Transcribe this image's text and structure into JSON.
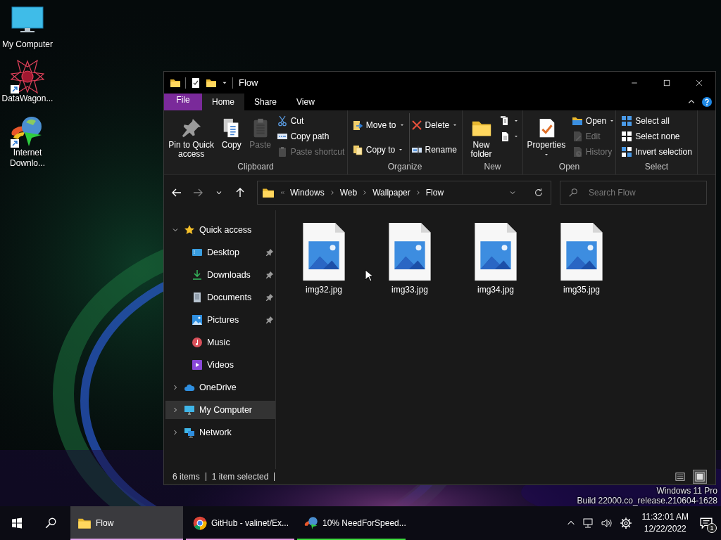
{
  "desktop": {
    "icons": [
      {
        "label": "My Computer"
      },
      {
        "label": "DataWagon..."
      },
      {
        "label": "Internet Downlo..."
      }
    ],
    "edition": [
      "Windows 11 Pro",
      "Build 22000.co_release.210604-1628"
    ]
  },
  "window": {
    "title": "Flow",
    "ribbon_tabs": [
      {
        "label": "File",
        "kind": "file",
        "selected": false
      },
      {
        "label": "Home",
        "kind": "tab",
        "selected": true
      },
      {
        "label": "Share",
        "kind": "tab",
        "selected": false
      },
      {
        "label": "View",
        "kind": "tab",
        "selected": false
      }
    ],
    "ribbon_groups": [
      {
        "label": "Clipboard",
        "columns": [
          [
            {
              "label": "Pin to Quick access",
              "kind": "large",
              "disabled": false,
              "dropdown": false
            }
          ],
          [
            {
              "label": "Copy",
              "kind": "large",
              "disabled": false,
              "dropdown": false
            }
          ],
          [
            {
              "label": "Paste",
              "kind": "large",
              "disabled": true,
              "dropdown": false
            }
          ],
          [
            {
              "label": "Cut",
              "kind": "small",
              "disabled": false,
              "dropdown": false
            },
            {
              "label": "Copy path",
              "kind": "small",
              "disabled": false,
              "dropdown": false
            },
            {
              "label": "Paste shortcut",
              "kind": "small",
              "disabled": true,
              "dropdown": false
            }
          ]
        ]
      },
      {
        "label": "Organize",
        "columns": [
          [
            {
              "label": "Move to",
              "kind": "medium",
              "disabled": false,
              "dropdown": true
            },
            {
              "label": "Copy to",
              "kind": "medium",
              "disabled": false,
              "dropdown": true
            }
          ],
          [
            {
              "label": "Delete",
              "kind": "medium",
              "disabled": false,
              "dropdown": true
            },
            {
              "label": "Rename",
              "kind": "medium",
              "disabled": false,
              "dropdown": false
            }
          ]
        ]
      },
      {
        "label": "New",
        "columns": [
          [
            {
              "label": "New folder",
              "kind": "large",
              "disabled": false,
              "dropdown": false
            }
          ],
          [
            {
              "kind": "small",
              "disabled": false,
              "dropdown": true
            },
            {
              "kind": "small",
              "disabled": false,
              "dropdown": true
            }
          ]
        ]
      },
      {
        "label": "Open",
        "columns": [
          [
            {
              "label": "Properties",
              "kind": "large",
              "disabled": false,
              "dropdown": true
            }
          ],
          [
            {
              "label": "Open",
              "kind": "small",
              "disabled": false,
              "dropdown": true
            },
            {
              "label": "Edit",
              "kind": "small",
              "disabled": true,
              "dropdown": false
            },
            {
              "label": "History",
              "kind": "small",
              "disabled": true,
              "dropdown": false
            }
          ]
        ]
      },
      {
        "label": "Select",
        "columns": [
          [
            {
              "label": "Select all",
              "kind": "small",
              "disabled": false,
              "dropdown": false
            },
            {
              "label": "Select none",
              "kind": "small",
              "disabled": false,
              "dropdown": false
            },
            {
              "label": "Invert selection",
              "kind": "small",
              "disabled": false,
              "dropdown": false
            }
          ]
        ]
      }
    ],
    "nav_buttons": [
      {
        "kind": "back",
        "disabled": false
      },
      {
        "kind": "forward",
        "disabled": true
      },
      {
        "kind": "recent",
        "disabled": false
      },
      {
        "kind": "up",
        "disabled": false
      }
    ],
    "address": {
      "crumbs": [
        "Windows",
        "Web",
        "Wallpaper",
        "Flow"
      ]
    },
    "search": {
      "placeholder": "Search Flow"
    },
    "tree": [
      {
        "label": "Quick access",
        "expanded": true,
        "selected": false,
        "children": [
          {
            "label": "Desktop",
            "pinned": true,
            "selected": false
          },
          {
            "label": "Downloads",
            "pinned": true,
            "selected": false
          },
          {
            "label": "Documents",
            "pinned": true,
            "selected": false
          },
          {
            "label": "Pictures",
            "pinned": true,
            "selected": false
          },
          {
            "label": "Music",
            "pinned": false,
            "selected": false
          },
          {
            "label": "Videos",
            "pinned": false,
            "selected": false
          }
        ]
      },
      {
        "label": "OneDrive",
        "expanded": false,
        "selected": false
      },
      {
        "label": "My Computer",
        "expanded": false,
        "selected": true
      },
      {
        "label": "Network",
        "expanded": false,
        "selected": false
      }
    ],
    "files": [
      {
        "name": "img32.jpg",
        "selected": false
      },
      {
        "name": "img33.jpg",
        "selected": false
      },
      {
        "name": "img34.jpg",
        "selected": false
      },
      {
        "name": "img35.jpg",
        "selected": false
      }
    ],
    "status": {
      "item_count": "6 items",
      "selection": "1 item selected"
    },
    "view_buttons": [
      {
        "kind": "details",
        "selected": false
      },
      {
        "kind": "large-icons",
        "selected": true
      }
    ]
  },
  "taskbar": {
    "apps": [
      {
        "label": "Flow",
        "active": true,
        "color": "#e4a4e8"
      },
      {
        "label": "GitHub - valinet/Ex...",
        "active": false,
        "color": "#e79ce3"
      },
      {
        "label": "10% NeedForSpeed...",
        "active": false,
        "color": "#3ddc3d"
      }
    ],
    "time": "11:32:01 AM",
    "date": "12/22/2022",
    "notification_count": "1"
  }
}
